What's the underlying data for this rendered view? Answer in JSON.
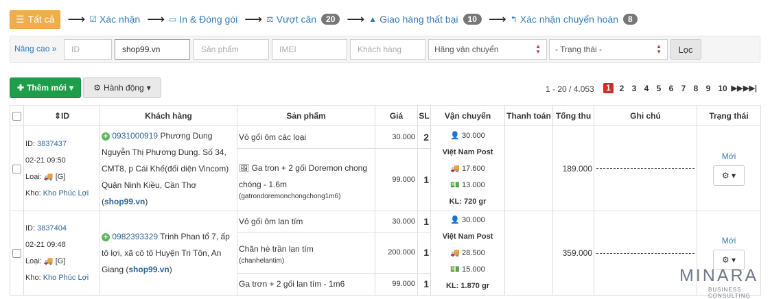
{
  "flow": {
    "all_label": "Tất cả",
    "steps": [
      {
        "label": "Xác nhận",
        "icon": "check-square-icon"
      },
      {
        "label": "In & Đóng gói",
        "icon": "inbox-icon"
      },
      {
        "label": "Vượt cân",
        "icon": "scale-icon",
        "badge": "20"
      },
      {
        "label": "Giao hàng thất bại",
        "icon": "warning-icon",
        "badge": "10"
      },
      {
        "label": "Xác nhận chuyển hoàn",
        "icon": "reply-icon",
        "badge": "8"
      }
    ]
  },
  "filter": {
    "advanced_label": "Nâng cao",
    "id_placeholder": "ID",
    "shop_value": "shop99.vn",
    "product_placeholder": "Sản phẩm",
    "imei_placeholder": "IMEI",
    "customer_placeholder": "Khách hàng",
    "carrier_select": "Hãng vận chuyển",
    "status_select": "- Trạng thái -",
    "filter_button": "Lọc"
  },
  "toolbar": {
    "add_label": "Thêm mới",
    "action_label": "Hành động",
    "range": "1 - 20 / 4.053",
    "pages": [
      "1",
      "2",
      "3",
      "4",
      "5",
      "6",
      "7",
      "8",
      "9",
      "10"
    ],
    "active_page": "1"
  },
  "table": {
    "headers": {
      "id": "ID",
      "customer": "Khách hàng",
      "product": "Sản phẩm",
      "price": "Giá",
      "qty": "SL",
      "shipping": "Vận chuyển",
      "payment": "Thanh toán",
      "total": "Tổng thu",
      "note": "Ghi chú",
      "status": "Trạng thái"
    },
    "rows": [
      {
        "id_label": "ID:",
        "id": "3837437",
        "datetime": "02-21 09:50",
        "type_label": "Loại:",
        "type": "[G]",
        "store_label": "Kho:",
        "store": "Kho Phúc Lợi",
        "phone": "0931000919",
        "name": "Phương Dung",
        "address": "Nguyễn Thị Phương Dung. Số 34, CMT8, p Cái Khế(đối diện Vincom) Quận Ninh Kiều, Cần Thơ",
        "shop": "shop99.vn",
        "products": [
          {
            "name": "Vỏ gối ôm các loại",
            "sku": "",
            "price": "30.000",
            "qty": "2",
            "has_image": false
          },
          {
            "name": "Ga tron + 2 gối Doremon chong chóng - 1.6m",
            "sku": "(gatrondoremonchongchong1m6)",
            "price": "99.000",
            "qty": "1",
            "has_image": true
          }
        ],
        "ship_fee": "30.000",
        "carrier": "Việt Nam Post",
        "ship_cost": "17.600",
        "cod_fee": "13.000",
        "weight": "KL: 720 gr",
        "total": "189.000",
        "status": "Mới"
      },
      {
        "id_label": "ID:",
        "id": "3837404",
        "datetime": "02-21 09:48",
        "type_label": "Loại:",
        "type": "[G]",
        "store_label": "Kho:",
        "store": "Kho Phúc Lợi",
        "phone": "0982393329",
        "name": "Trinh Phan",
        "address": "tổ 7, ấp tô lợi, xã cô tô Huyện Tri Tôn, An Giang",
        "shop": "shop99.vn",
        "products": [
          {
            "name": "Vỏ gối ôm lan tím",
            "sku": "",
            "price": "30.000",
            "qty": "1",
            "has_image": false
          },
          {
            "name": "Chăn hè trần lan tím",
            "sku": "(chanhelantim)",
            "price": "200.000",
            "qty": "1",
            "has_image": false
          },
          {
            "name": "Ga trơn + 2 gối lan tím - 1m6",
            "sku": "",
            "price": "99.000",
            "qty": "1",
            "has_image": false
          }
        ],
        "ship_fee": "30.000",
        "carrier": "Việt Nam Post",
        "ship_cost": "28.500",
        "cod_fee": "15.000",
        "weight": "KL: 1.870 gr",
        "total": "359.000",
        "status": "Mới"
      }
    ]
  },
  "watermark": {
    "name": "MINARA",
    "sub": "BUSINESS CONSULTING"
  }
}
